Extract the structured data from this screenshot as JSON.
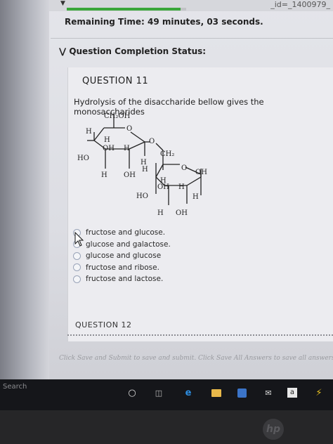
{
  "header": {
    "url_fragment": "_id=_1400979_",
    "remaining_time": "Remaining Time: 49 minutes, 03 seconds.",
    "completion_status": "Question Completion Status:"
  },
  "question": {
    "title": "QUESTION 11",
    "prompt": "Hydrolysis of the disaccharide bellow gives the monosaccharides",
    "options": [
      "fructose and glucose.",
      "glucose and galactose.",
      "glucose and glucose",
      "fructose and ribose.",
      "fructose and lactose."
    ]
  },
  "molecule": {
    "ring1_ch2oh": "CH₂OH",
    "ring1_o": "O",
    "ring1_h_top": "H",
    "ring1_h_inner": "H",
    "ring1_oh_inner": "OH",
    "ring1_h_right": "H",
    "ring1_ho": "HO",
    "ring1_h_bottom": "H",
    "ring1_oh_bottom": "OH",
    "bridge_o": "O",
    "ring2_ch2": "CH₂",
    "ring2_o": "O",
    "ring2_h_left1": "H",
    "ring2_h_left2": "H",
    "ring2_oh_right": "OH",
    "ring2_h_inner": "H",
    "ring2_oh_inner": "OH",
    "ring2_h_mid": "H",
    "ring2_ho": "HO",
    "ring2_h_right": "H",
    "ring2_h_bottom": "H",
    "ring2_oh_bottom": "OH"
  },
  "next_question": {
    "title": "QUESTION 12"
  },
  "footer": {
    "hint": "Click Save and Submit to save and submit. Click Save All Answers to save all answers."
  },
  "taskbar": {
    "search_label": "Search"
  },
  "progress": {
    "fraction": 0.95
  },
  "colors": {
    "progress_green": "#3aa63a",
    "radio_border": "#9aa4b8"
  }
}
